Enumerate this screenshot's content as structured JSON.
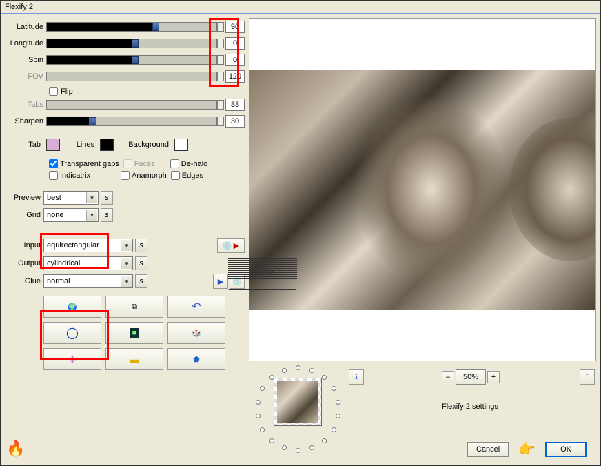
{
  "window": {
    "title": "Flexify 2"
  },
  "sliders": {
    "latitude": {
      "label": "Latitude",
      "value": "90"
    },
    "longitude": {
      "label": "Longitude",
      "value": "0"
    },
    "spin": {
      "label": "Spin",
      "value": "0"
    },
    "fov": {
      "label": "FOV",
      "value": "120"
    },
    "tabs": {
      "label": "Tabs",
      "value": "33"
    },
    "sharpen": {
      "label": "Sharpen",
      "value": "30"
    }
  },
  "checkboxes": {
    "flip": "Flip",
    "transparent_gaps": "Transparent gaps",
    "faces": "Faces",
    "dehalo": "De-halo",
    "indicatrix": "Indicatrix",
    "anamorph": "Anamorph",
    "edges": "Edges"
  },
  "colors": {
    "tab_label": "Tab",
    "tab_color": "#d8aed8",
    "lines_label": "Lines",
    "lines_color": "#000000",
    "background_label": "Background",
    "background_color": "#ffffff"
  },
  "combos": {
    "preview": {
      "label": "Preview",
      "value": "best"
    },
    "grid": {
      "label": "Grid",
      "value": "none"
    },
    "input": {
      "label": "Input",
      "value": "equirectangular"
    },
    "output": {
      "label": "Output",
      "value": "cylindrical"
    },
    "glue": {
      "label": "Glue",
      "value": "normal"
    }
  },
  "sbtn_label": "s",
  "bottom": {
    "zoom": "50%",
    "settings_label": "Flexify 2 settings",
    "cancel": "Cancel",
    "ok": "OK",
    "minus": "–",
    "plus": "+",
    "info": "i",
    "tri": "ˆ"
  },
  "watermark": "claudia"
}
